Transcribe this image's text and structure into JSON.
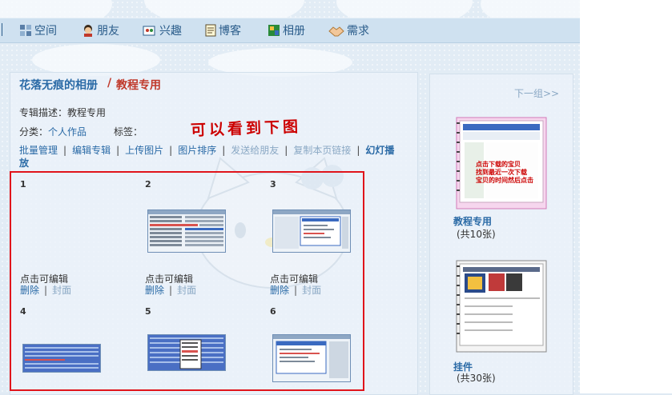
{
  "nav": {
    "space": "空间",
    "friends": "朋友",
    "interests": "兴趣",
    "blog": "博客",
    "album": "相册",
    "needs": "需求"
  },
  "album": {
    "owner_title": "花落无痕的相册",
    "separator": "/",
    "name": "教程专用",
    "description": "专辑描述：教程专用",
    "category_label": "分类：",
    "category_value": "个人作品",
    "tags_label": "标签："
  },
  "annotation": "可以看到下图",
  "actions": {
    "batch": "批量管理",
    "edit_album": "编辑专辑",
    "upload": "上传图片",
    "sort": "图片排序",
    "send_friends": "发送给朋友",
    "copy_link": "复制本页链接",
    "slideshow": "幻灯播放"
  },
  "photos": [
    {
      "num": "1",
      "caption": "点击可编辑",
      "delete": "删除",
      "cover": "封面"
    },
    {
      "num": "2",
      "caption": "点击可编辑",
      "delete": "删除",
      "cover": "封面"
    },
    {
      "num": "3",
      "caption": "点击可编辑",
      "delete": "删除",
      "cover": "封面"
    },
    {
      "num": "4"
    },
    {
      "num": "5"
    },
    {
      "num": "6"
    }
  ],
  "sidebar": {
    "next_group": "下一组>>",
    "albums": [
      {
        "name": "教程专用",
        "count": "(共10张)"
      },
      {
        "name": "挂件",
        "count": "(共30张)"
      }
    ],
    "thumb1_lines": [
      "点击下载的宝贝",
      "找到最近一次下载",
      "宝贝的时间然后点击"
    ]
  },
  "colors": {
    "link": "#2a6aa6",
    "accent_red": "#c0392b",
    "highlight_box": "#e0141b",
    "muted_link": "#8aa8c4"
  }
}
